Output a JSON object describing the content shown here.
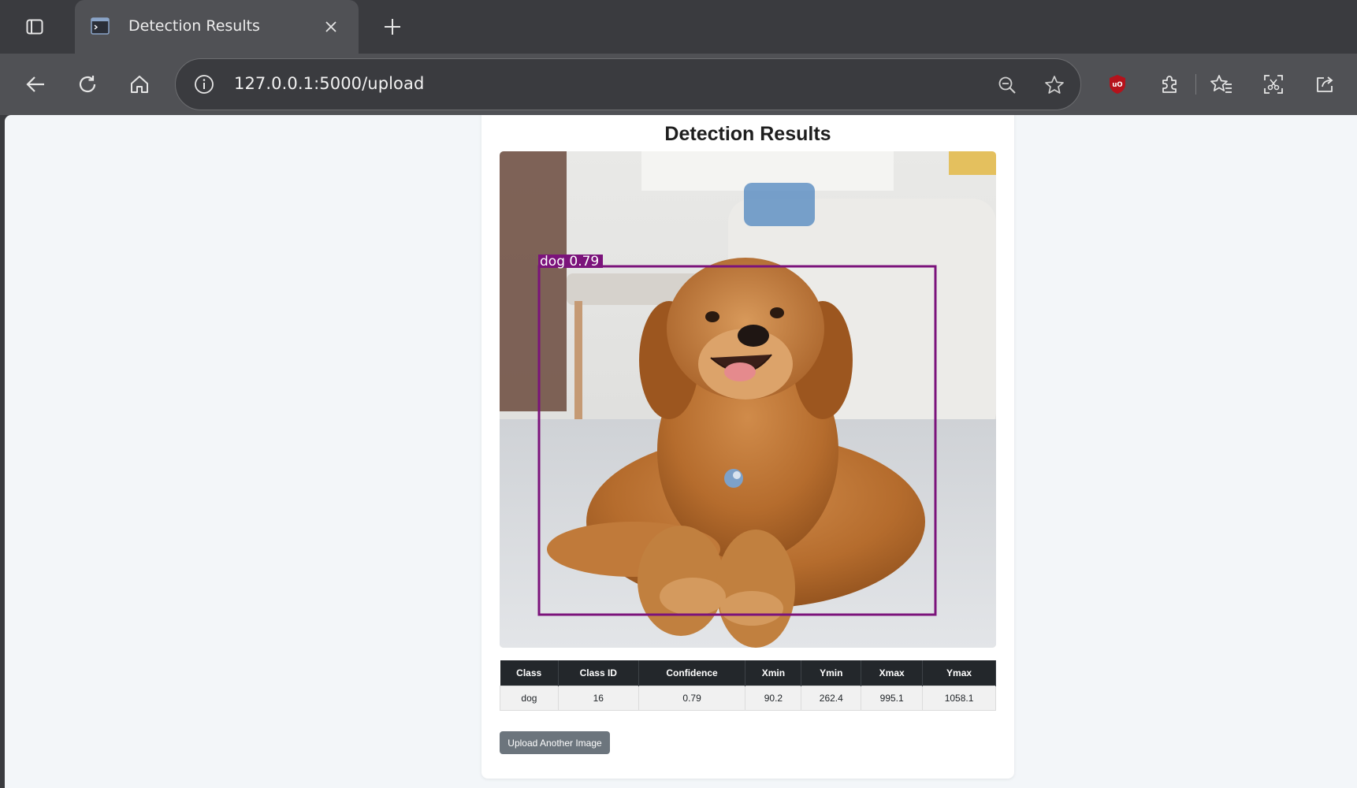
{
  "browser": {
    "tab": {
      "title": "Detection Results"
    },
    "omnibox": {
      "url": "127.0.0.1:5000/upload"
    }
  },
  "page": {
    "title": "Detection Results",
    "image": {
      "label": "dog 0.79",
      "box_color": "#7b137b",
      "subject": "golden retriever lying on rug"
    },
    "table": {
      "headers": [
        "Class",
        "Class ID",
        "Confidence",
        "Xmin",
        "Ymin",
        "Xmax",
        "Ymax"
      ],
      "rows": [
        [
          "dog",
          "16",
          "0.79",
          "90.2",
          "262.4",
          "995.1",
          "1058.1"
        ]
      ]
    },
    "upload_button": "Upload Another Image"
  },
  "icons": {
    "tab_actions": "tab-actions-icon",
    "close": "close-icon",
    "new_tab": "plus-icon",
    "back": "back-arrow-icon",
    "refresh": "refresh-icon",
    "home": "home-icon",
    "info": "info-icon",
    "zoom": "zoom-out-icon",
    "star": "star-icon",
    "ublock": "ublock-icon",
    "extensions": "puzzle-icon",
    "favorites": "favorites-icon",
    "screenshot": "screenshot-icon",
    "share": "share-icon"
  },
  "colors": {
    "chrome_dark": "#3a3b3f",
    "chrome_mid": "#505155",
    "page_bg": "#f3f6f9",
    "table_header": "#23272b",
    "button": "#6c757d",
    "ublock_red": "#b5121b"
  }
}
